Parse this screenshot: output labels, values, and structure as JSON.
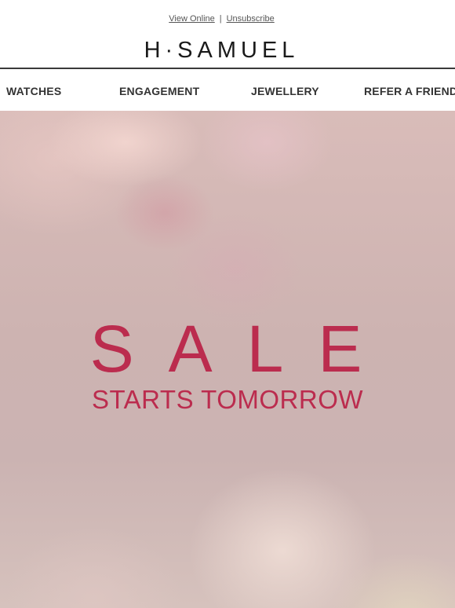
{
  "header": {
    "view_online": "View Online",
    "separator": "|",
    "unsubscribe": "Unsubscribe",
    "logo": "H·SAMUEL"
  },
  "nav": {
    "items": [
      {
        "label": "WATCHES"
      },
      {
        "label": "ENGAGEMENT"
      },
      {
        "label": "JEWELLERY"
      },
      {
        "label": "REFER A FRIEND"
      }
    ]
  },
  "hero": {
    "title": "SALE",
    "subtitle": "STARTS TOMORROW",
    "accent_color": "#bb2c4e"
  }
}
